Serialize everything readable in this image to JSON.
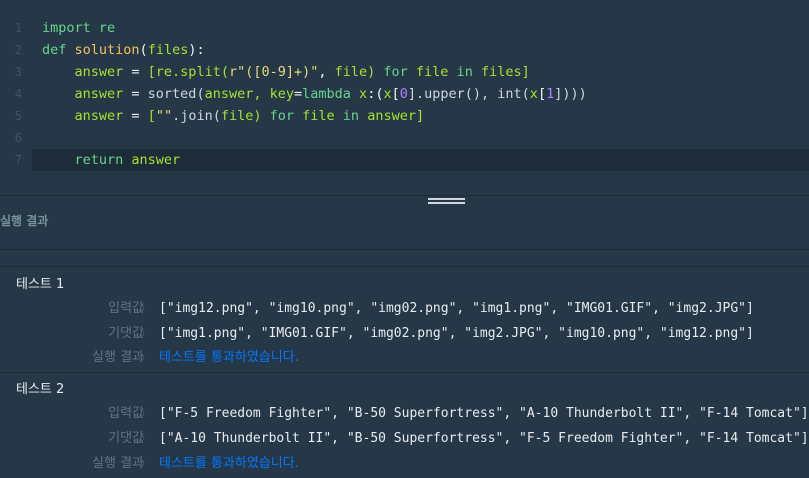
{
  "editor": {
    "lines": [
      {
        "num": "1",
        "segments": [
          {
            "t": "import re",
            "c": "kw"
          }
        ]
      },
      {
        "num": "2",
        "segments": [
          {
            "t": "def ",
            "c": "kw"
          },
          {
            "t": "solution",
            "c": "fn"
          },
          {
            "t": "(",
            "c": "op"
          },
          {
            "t": "files",
            "c": "id"
          },
          {
            "t": "):",
            "c": "op"
          }
        ]
      },
      {
        "num": "3",
        "segments": [
          {
            "t": "    answer ",
            "c": "id"
          },
          {
            "t": "= ",
            "c": "op"
          },
          {
            "t": "[re.split(",
            "c": "id"
          },
          {
            "t": "r\"([0-9]+)\"",
            "c": "str"
          },
          {
            "t": ", ",
            "c": "op"
          },
          {
            "t": "file) ",
            "c": "id"
          },
          {
            "t": "for ",
            "c": "kw"
          },
          {
            "t": "file ",
            "c": "id"
          },
          {
            "t": "in ",
            "c": "kw"
          },
          {
            "t": "files]",
            "c": "id"
          }
        ]
      },
      {
        "num": "4",
        "segments": [
          {
            "t": "    answer ",
            "c": "id"
          },
          {
            "t": "= ",
            "c": "op"
          },
          {
            "t": "sorted(",
            "c": "pl"
          },
          {
            "t": "answer, ",
            "c": "id"
          },
          {
            "t": "key",
            "c": "id"
          },
          {
            "t": "=",
            "c": "op"
          },
          {
            "t": "lambda ",
            "c": "kw"
          },
          {
            "t": "x",
            "c": "id"
          },
          {
            "t": ":(",
            "c": "op"
          },
          {
            "t": "x",
            "c": "id"
          },
          {
            "t": "[",
            "c": "op"
          },
          {
            "t": "0",
            "c": "num"
          },
          {
            "t": "].upper(), int(",
            "c": "pl"
          },
          {
            "t": "x",
            "c": "id"
          },
          {
            "t": "[",
            "c": "op"
          },
          {
            "t": "1",
            "c": "num"
          },
          {
            "t": "])))",
            "c": "pl"
          }
        ]
      },
      {
        "num": "5",
        "segments": [
          {
            "t": "    answer ",
            "c": "id"
          },
          {
            "t": "= ",
            "c": "op"
          },
          {
            "t": "[",
            "c": "id"
          },
          {
            "t": "\"\"",
            "c": "str"
          },
          {
            "t": ".join(",
            "c": "pl"
          },
          {
            "t": "file) ",
            "c": "id"
          },
          {
            "t": "for ",
            "c": "kw"
          },
          {
            "t": "file ",
            "c": "id"
          },
          {
            "t": "in ",
            "c": "kw"
          },
          {
            "t": "answer]",
            "c": "id"
          }
        ]
      },
      {
        "num": "6",
        "segments": []
      },
      {
        "num": "7",
        "segments": [
          {
            "t": "    return ",
            "c": "kw"
          },
          {
            "t": "answer",
            "c": "id"
          }
        ]
      }
    ]
  },
  "result_header": "실행 결과",
  "tests": [
    {
      "title": "테스트 1",
      "input_label": "입력값",
      "input": "[\"img12.png\", \"img10.png\", \"img02.png\", \"img1.png\", \"IMG01.GIF\", \"img2.JPG\"]",
      "expected_label": "기댓값",
      "expected": "[\"img1.png\", \"IMG01.GIF\", \"img02.png\", \"img2.JPG\", \"img10.png\", \"img12.png\"]",
      "result_label": "실행 결과",
      "result": "테스트를 통과하였습니다."
    },
    {
      "title": "테스트 2",
      "input_label": "입력값",
      "input": "[\"F-5 Freedom Fighter\", \"B-50 Superfortress\", \"A-10 Thunderbolt II\", \"F-14 Tomcat\"]",
      "expected_label": "기댓값",
      "expected": "[\"A-10 Thunderbolt II\", \"B-50 Superfortress\", \"F-5 Freedom Fighter\", \"F-14 Tomcat\"]",
      "result_label": "실행 결과",
      "result": "테스트를 통과하였습니다."
    }
  ],
  "chevron": "〉"
}
